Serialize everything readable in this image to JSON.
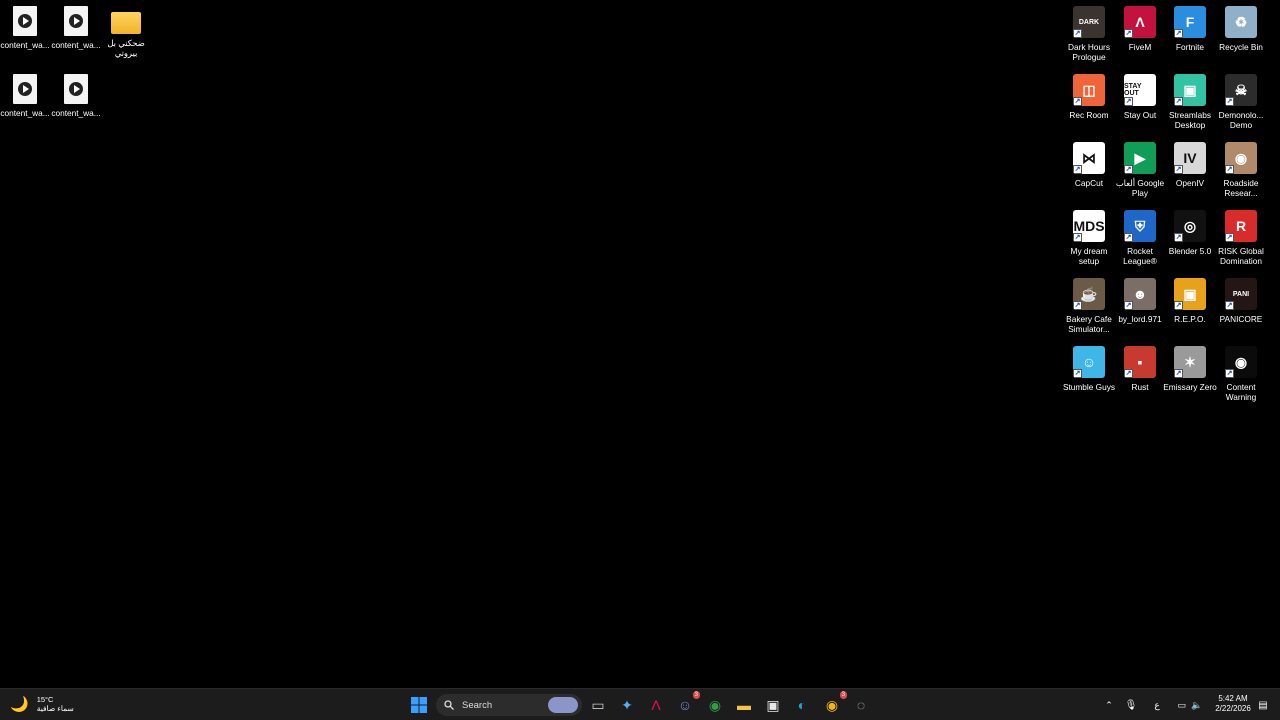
{
  "desktop": {
    "left_icons": [
      {
        "label": "content_wa...",
        "type": "video-file"
      },
      {
        "label": "content_wa...",
        "type": "video-file"
      },
      {
        "label": "ضحكني بل\nبيروتي",
        "type": "folder"
      },
      {
        "label": "content_wa...",
        "type": "video-file"
      },
      {
        "label": "content_wa...",
        "type": "video-file"
      }
    ],
    "right_icons": [
      {
        "label": "Dark Hours Prologue",
        "icon": "dark-hours-icon",
        "color": "#3a3330",
        "glyph": "DARK"
      },
      {
        "label": "FiveM",
        "icon": "fivem-icon",
        "color": "#c4123f",
        "glyph": "Λ"
      },
      {
        "label": "Fortnite",
        "icon": "fortnite-icon",
        "color": "#2b8de0",
        "glyph": "F"
      },
      {
        "label": "Recycle Bin",
        "icon": "recycle-bin-icon",
        "color": "#8fb0c8",
        "glyph": "♻"
      },
      {
        "label": "Rec Room",
        "icon": "rec-room-icon",
        "color": "#f0643a",
        "glyph": "◫"
      },
      {
        "label": "Stay Out",
        "icon": "stay-out-icon",
        "color": "#ffffff",
        "glyph": "STAY OUT"
      },
      {
        "label": "Streamlabs Desktop",
        "icon": "streamlabs-icon",
        "color": "#31c3a2",
        "glyph": "▣"
      },
      {
        "label": "Demonolo... Demo",
        "icon": "demonologist-icon",
        "color": "#2c2c2c",
        "glyph": "☠"
      },
      {
        "label": "CapCut",
        "icon": "capcut-icon",
        "color": "#ffffff",
        "glyph": "⋈"
      },
      {
        "label": "ألعاب Google Play",
        "icon": "google-play-games-icon",
        "color": "#0f9d58",
        "glyph": "▶"
      },
      {
        "label": "OpenIV",
        "icon": "openiv-icon",
        "color": "#d8d8d8",
        "glyph": "IV"
      },
      {
        "label": "Roadside Resear...",
        "icon": "roadside-research-icon",
        "color": "#b08a6a",
        "glyph": "◉"
      },
      {
        "label": "My dream setup",
        "icon": "my-dream-setup-icon",
        "color": "#ffffff",
        "glyph": "MDS"
      },
      {
        "label": "Rocket League®",
        "icon": "rocket-league-icon",
        "color": "#1f66c9",
        "glyph": "⛨"
      },
      {
        "label": "Blender 5.0",
        "icon": "blender-icon",
        "color": "#111111",
        "glyph": "◎"
      },
      {
        "label": "RISK Global Domination",
        "icon": "risk-icon",
        "color": "#d92b2b",
        "glyph": "R"
      },
      {
        "label": "Bakery Cafe Simulator...",
        "icon": "bakery-cafe-icon",
        "color": "#6b5a45",
        "glyph": "☕"
      },
      {
        "label": "by_lord.971",
        "icon": "by-lord-icon",
        "color": "#7a6e66",
        "glyph": "☻"
      },
      {
        "label": "R.E.P.O.",
        "icon": "repo-icon",
        "color": "#e7a21a",
        "glyph": "▣"
      },
      {
        "label": "PANICORE",
        "icon": "panicore-icon",
        "color": "#251616",
        "glyph": "PANI"
      },
      {
        "label": "Stumble Guys",
        "icon": "stumble-guys-icon",
        "color": "#3fb6e8",
        "glyph": "☺"
      },
      {
        "label": "Rust",
        "icon": "rust-icon",
        "color": "#c83a2f",
        "glyph": "▪"
      },
      {
        "label": "Emissary Zero",
        "icon": "emissary-zero-icon",
        "color": "#9a9a9a",
        "glyph": "✶"
      },
      {
        "label": "Content Warning",
        "icon": "content-warning-icon",
        "color": "#0b0b0b",
        "glyph": "◉"
      }
    ]
  },
  "taskbar": {
    "weather": {
      "temp": "15°C",
      "desc": "سماء صافية"
    },
    "search_label": "Search",
    "apps": [
      {
        "name": "task-view-icon",
        "glyph": "▭",
        "color": "#cccccc"
      },
      {
        "name": "copilot-icon",
        "glyph": "✦",
        "color": "#4fb3ff"
      },
      {
        "name": "fivem-taskbar-icon",
        "glyph": "Λ",
        "color": "#e1154a"
      },
      {
        "name": "discord-icon",
        "glyph": "☺",
        "color": "#7289da"
      },
      {
        "name": "chrome-icon",
        "glyph": "◉",
        "color": "#2f9e44"
      },
      {
        "name": "file-explorer-icon",
        "glyph": "▬",
        "color": "#f5c242"
      },
      {
        "name": "microsoft-store-icon",
        "glyph": "▣",
        "color": "#e8e8e8"
      },
      {
        "name": "edge-icon",
        "glyph": "◐",
        "color": "#1fa5d6"
      },
      {
        "name": "chrome-canary-icon",
        "glyph": "◉",
        "color": "#f2b515"
      },
      {
        "name": "steam-like-icon",
        "glyph": "◌",
        "color": "#cccccc"
      }
    ],
    "discord_badge": "3",
    "canary_badge": "3",
    "tray_lang": "ع",
    "clock_time": "5:42 AM",
    "clock_date": "2/22/2026"
  }
}
